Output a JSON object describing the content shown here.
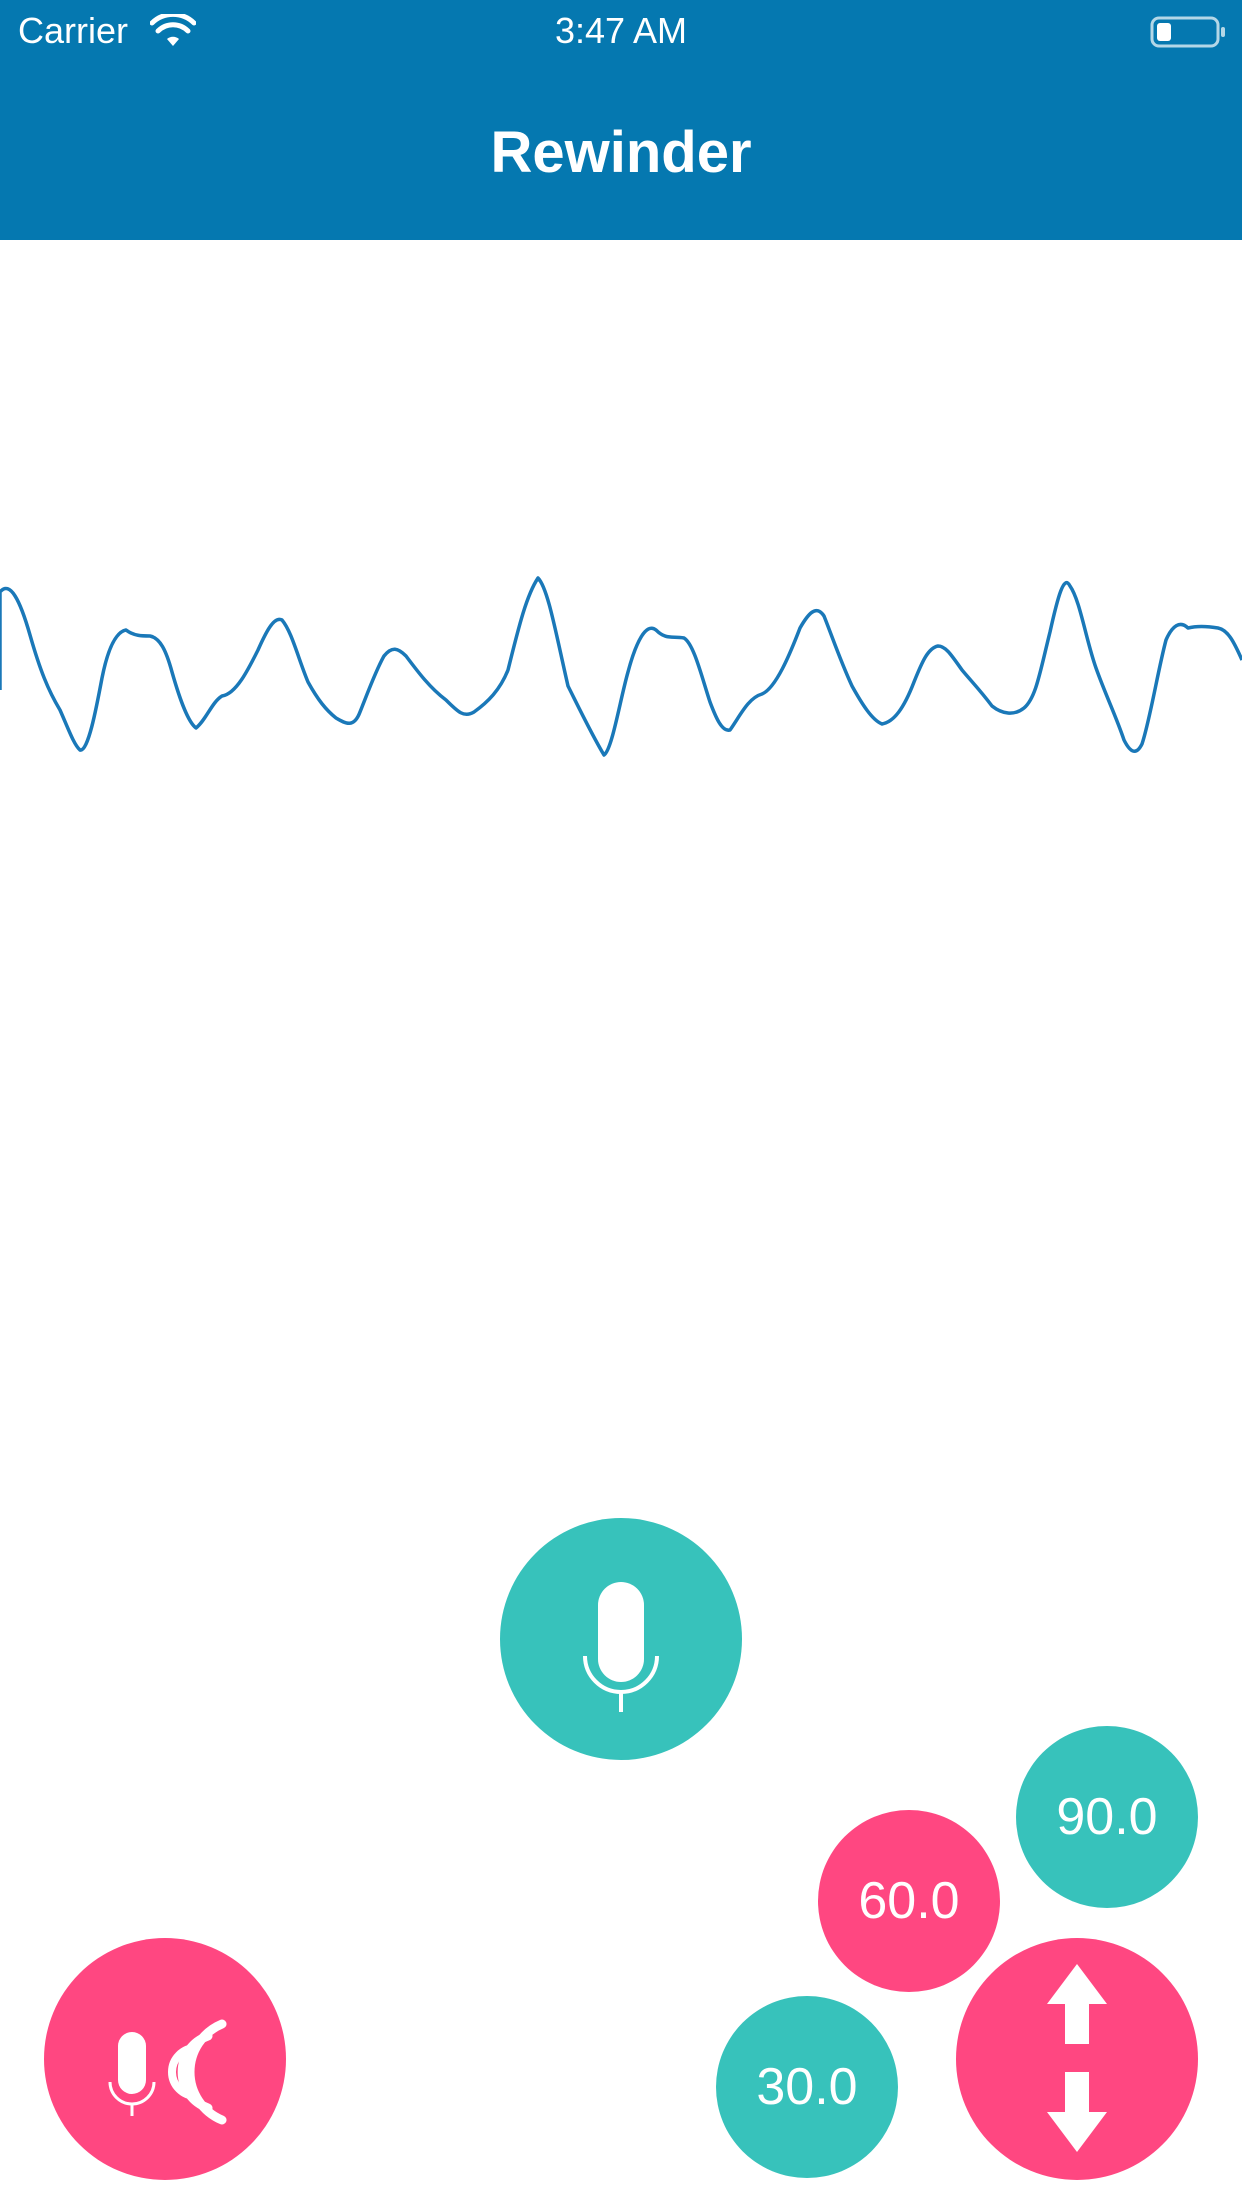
{
  "status_bar": {
    "carrier": "Carrier",
    "time": "3:47 AM",
    "battery_level": 0.2
  },
  "nav": {
    "title": "Rewinder"
  },
  "waveform": {
    "color": "#1a78b8"
  },
  "controls": {
    "record_icon": "microphone-icon",
    "listen_icon": "microphone-broadcast-icon",
    "direction_icon": "up-down-arrows-icon",
    "speed_options": [
      "90.0",
      "60.0",
      "30.0"
    ]
  },
  "colors": {
    "header": "#0578b0",
    "teal": "#37c2bb",
    "pink": "#ff4781"
  }
}
